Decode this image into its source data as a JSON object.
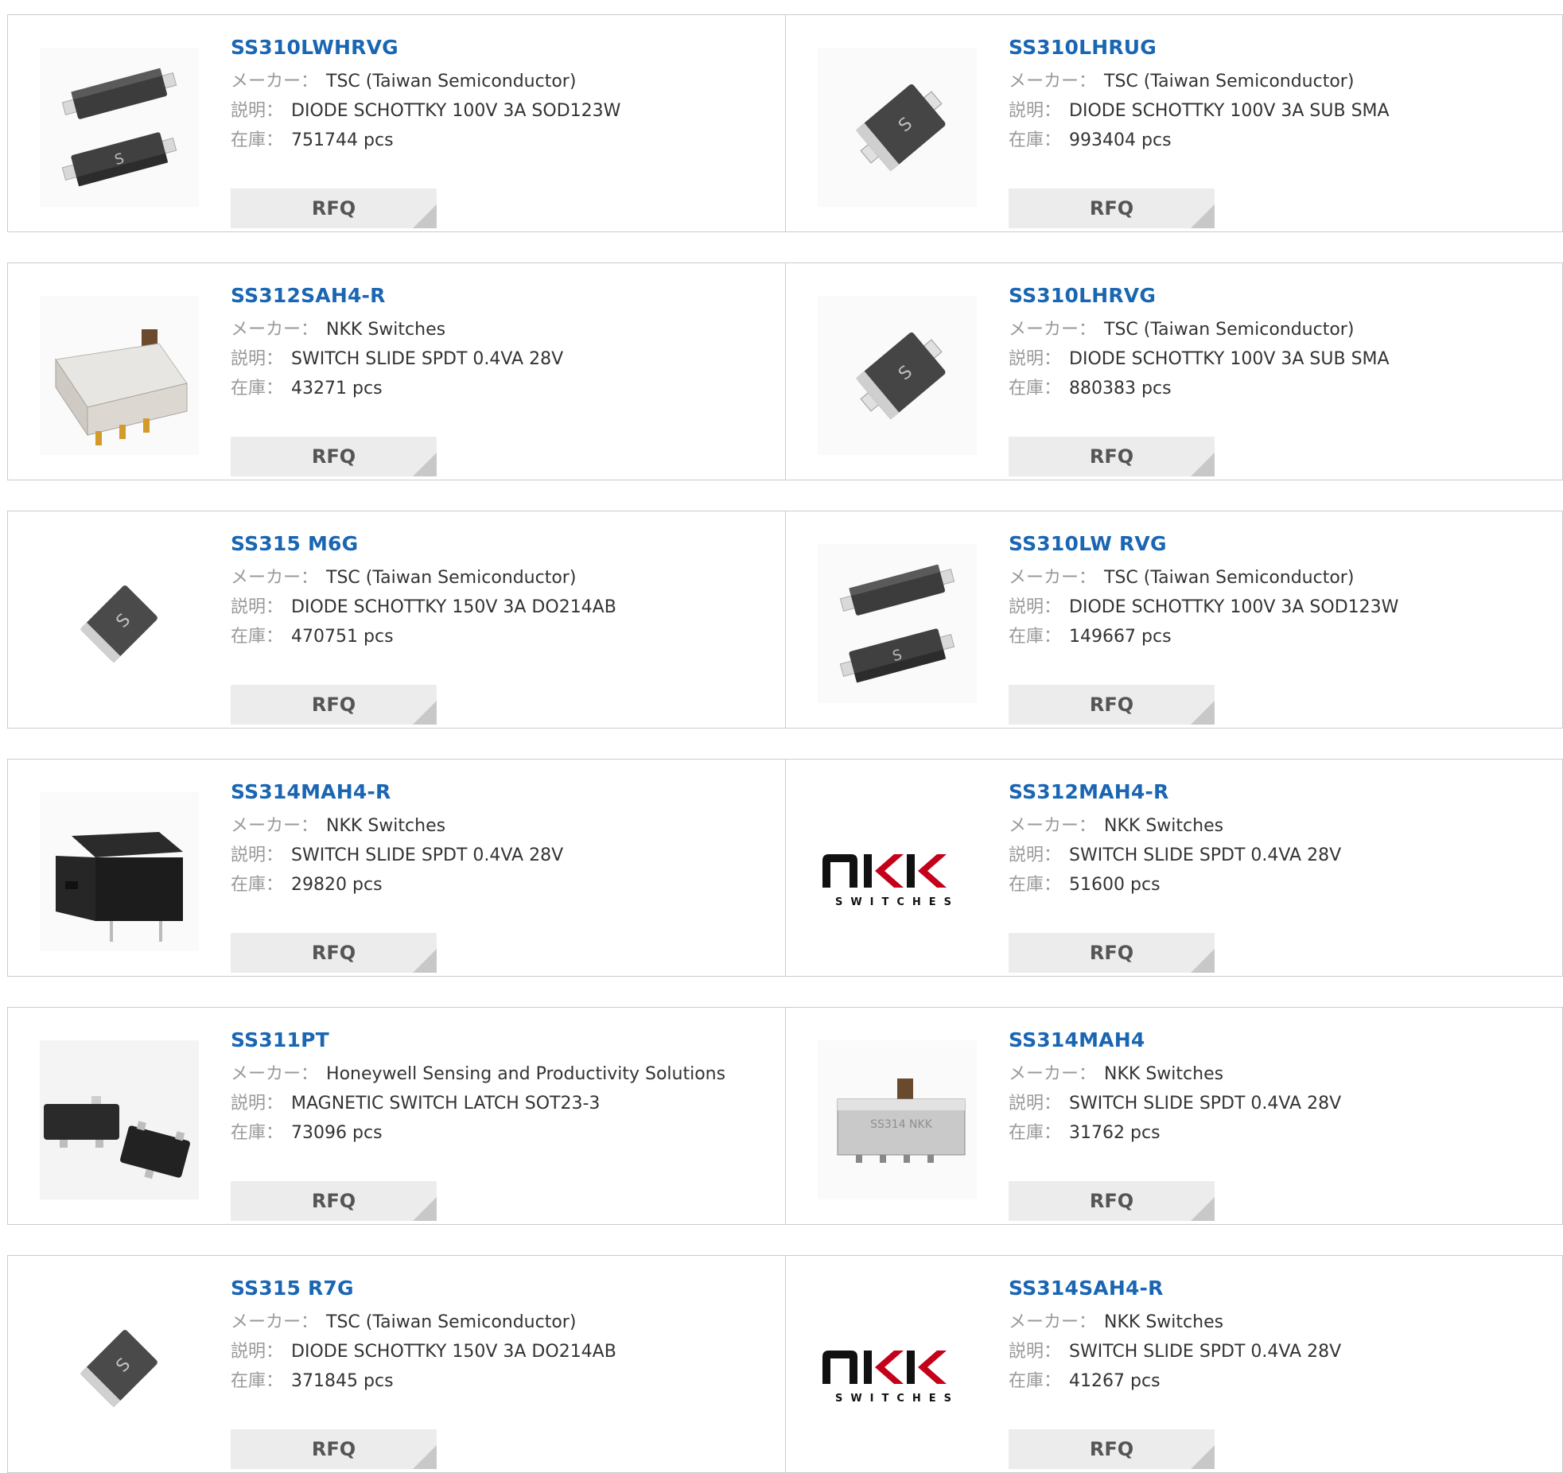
{
  "labels": {
    "manufacturer": "メーカー",
    "description": "説明",
    "stock": "在庫",
    "separator": "：",
    "stock_unit": "pcs",
    "rfq": "RFQ"
  },
  "colors": {
    "link": "#1a66b3",
    "label": "#999999",
    "button": "#ececec"
  },
  "products": [
    {
      "part": "SS310LWHRVG",
      "manufacturer": "TSC (Taiwan Semiconductor)",
      "description": "DIODE SCHOTTKY 100V 3A SOD123W",
      "stock": "751744",
      "image": "tsc-sod123w-icon"
    },
    {
      "part": "SS310LHRUG",
      "manufacturer": "TSC (Taiwan Semiconductor)",
      "description": "DIODE SCHOTTKY 100V 3A SUB SMA",
      "stock": "993404",
      "image": "tsc-sub-sma-icon"
    },
    {
      "part": "SS312SAH4-R",
      "manufacturer": "NKK Switches",
      "description": "SWITCH SLIDE SPDT 0.4VA 28V",
      "stock": "43271",
      "image": "slide-switch-white-icon"
    },
    {
      "part": "SS310LHRVG",
      "manufacturer": "TSC (Taiwan Semiconductor)",
      "description": "DIODE SCHOTTKY 100V 3A SUB SMA",
      "stock": "880383",
      "image": "tsc-sub-sma-icon"
    },
    {
      "part": "SS315 M6G",
      "manufacturer": "TSC (Taiwan Semiconductor)",
      "description": "DIODE SCHOTTKY 150V 3A DO214AB",
      "stock": "470751",
      "image": "tsc-do214ab-icon"
    },
    {
      "part": "SS310LW RVG",
      "manufacturer": "TSC (Taiwan Semiconductor)",
      "description": "DIODE SCHOTTKY 100V 3A SOD123W",
      "stock": "149667",
      "image": "tsc-sod123w-icon"
    },
    {
      "part": "SS314MAH4-R",
      "manufacturer": "NKK Switches",
      "description": "SWITCH SLIDE SPDT 0.4VA 28V",
      "stock": "29820",
      "image": "slide-switch-black-icon"
    },
    {
      "part": "SS312MAH4-R",
      "manufacturer": "NKK Switches",
      "description": "SWITCH SLIDE SPDT 0.4VA 28V",
      "stock": "51600",
      "image": "nkk-logo"
    },
    {
      "part": "SS311PT",
      "manufacturer": "Honeywell Sensing and Productivity Solutions",
      "description": "MAGNETIC SWITCH LATCH SOT23-3",
      "stock": "73096",
      "image": "sot23-3-icon"
    },
    {
      "part": "SS314MAH4",
      "manufacturer": "NKK Switches",
      "description": "SWITCH SLIDE SPDT 0.4VA 28V",
      "stock": "31762",
      "image": "slide-switch-metal-icon"
    },
    {
      "part": "SS315 R7G",
      "manufacturer": "TSC (Taiwan Semiconductor)",
      "description": "DIODE SCHOTTKY 150V 3A DO214AB",
      "stock": "371845",
      "image": "tsc-do214ab-icon"
    },
    {
      "part": "SS314SAH4-R",
      "manufacturer": "NKK Switches",
      "description": "SWITCH SLIDE SPDT 0.4VA 28V",
      "stock": "41267",
      "image": "nkk-logo"
    }
  ]
}
